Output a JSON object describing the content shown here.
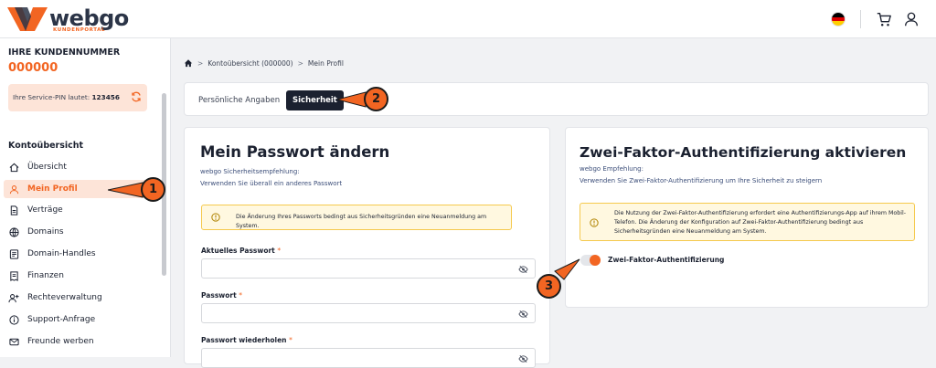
{
  "header": {
    "logo_text": "webgo",
    "logo_subtitle": "KUNDENPORTAL",
    "language_flag": "de",
    "icons": [
      "german-flag-icon",
      "cart-icon",
      "user-icon"
    ]
  },
  "sidebar": {
    "customer_number_label": "IHRE KUNDENNUMMER",
    "customer_number": "000000",
    "pin_label": "Ihre Service-PIN lautet:",
    "pin_value": "123456",
    "nav_title": "Kontoübersicht",
    "items": [
      {
        "label": "Übersicht",
        "icon": "home-icon",
        "active": false
      },
      {
        "label": "Mein Profil",
        "icon": "user-icon",
        "active": true
      },
      {
        "label": "Verträge",
        "icon": "document-icon",
        "active": false
      },
      {
        "label": "Domains",
        "icon": "globe-icon",
        "active": false
      },
      {
        "label": "Domain-Handles",
        "icon": "id-card-icon",
        "active": false
      },
      {
        "label": "Finanzen",
        "icon": "invoice-icon",
        "active": false
      },
      {
        "label": "Rechteverwaltung",
        "icon": "user-plus-icon",
        "active": false
      },
      {
        "label": "Support-Anfrage",
        "icon": "info-icon",
        "active": false
      },
      {
        "label": "Freunde werben",
        "icon": "mail-icon",
        "active": false
      }
    ]
  },
  "breadcrumb": {
    "items": [
      "Kontoübersicht (000000)",
      "Mein Profil"
    ]
  },
  "tabs": {
    "personal": "Persönliche Angaben",
    "security": "Sicherheit",
    "active": "security"
  },
  "password_card": {
    "title": "Mein Passwort ändern",
    "rec_heading": "webgo Sicherheitsempfehlung:",
    "rec_text": "Verwenden Sie überall ein anderes Passwort",
    "info": "Die Änderung Ihres Passworts bedingt aus Sicherheitsgründen eine Neuanmeldung am System.",
    "fields": [
      {
        "label": "Aktuelles Passwort",
        "value": ""
      },
      {
        "label": "Passwort",
        "value": ""
      },
      {
        "label": "Passwort wiederholen",
        "value": ""
      }
    ],
    "required_marker": "*"
  },
  "twofa_card": {
    "title": "Zwei-Faktor-Authentifizierung aktivieren",
    "rec_heading": "webgo Empfehlung:",
    "rec_text": "Verwenden Sie Zwei-Faktor-Authentifizierung um Ihre Sicherheit zu steigern",
    "info_line1": "Die Nutzung der Zwei-Faktor-Authentifizierung erfordert eine Authentifizierungs-App auf ihrem Mobil-",
    "info_line2": "Telefon. Die Änderung der Konfiguration auf Zwei-Faktor-Authentifizierung bedingt aus",
    "info_line3": "Sicherheitsgründen eine Neuanmeldung am System.",
    "toggle_label": "Zwei-Faktor-Authentifizierung",
    "toggle_on": true
  },
  "callouts": [
    "1",
    "2",
    "3"
  ],
  "colors": {
    "accent": "#f26522",
    "dark": "#1b2130",
    "info_bg": "#fff8e0",
    "info_border": "#f5c94d",
    "active_bg": "#fde4d8"
  }
}
